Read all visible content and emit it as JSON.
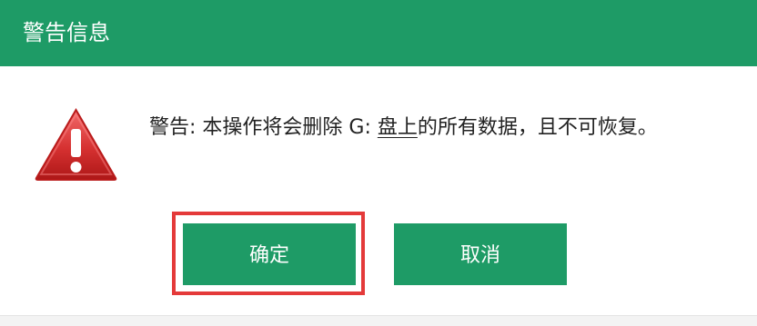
{
  "dialog": {
    "title": "警告信息",
    "message": {
      "prefix": "警告: 本操作将会删除 G: ",
      "drive_text": "盘上",
      "suffix": "的所有数据，且不可恢复。"
    },
    "buttons": {
      "ok": "确定",
      "cancel": "取消"
    },
    "highlighted_button": "确定",
    "icon": "warning-triangle-icon"
  },
  "colors": {
    "titlebar": "#1e9b66",
    "button": "#1e9b66",
    "highlight": "#e43a3a",
    "warning_icon": "#d92f2f"
  }
}
